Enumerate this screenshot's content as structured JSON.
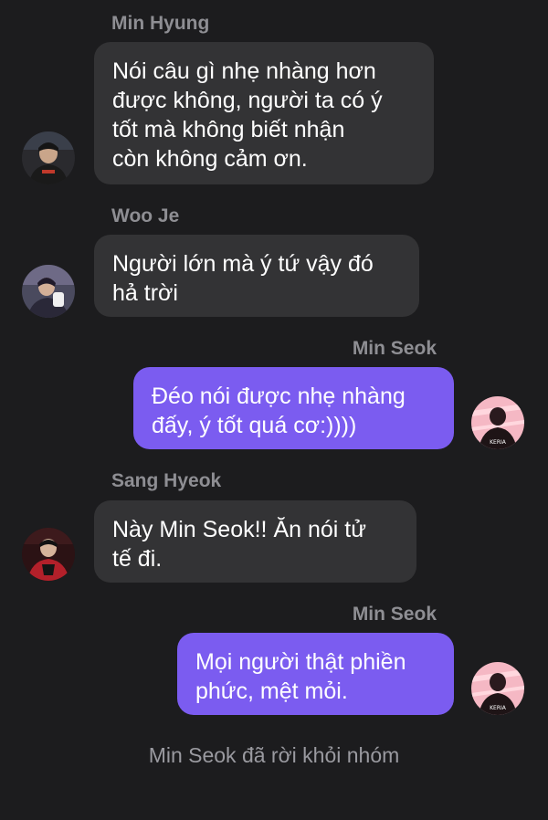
{
  "colors": {
    "background": "#1c1c1e",
    "incoming_bubble": "#333335",
    "outgoing_bubble": "#7b5cf0",
    "sender_name": "#8e8e93"
  },
  "messages": [
    {
      "sender": "Min Hyung",
      "text": "Nói câu gì nhẹ nhàng hơn\nđược không, người ta có ý\ntốt mà không biết nhận\ncòn không cảm ơn.",
      "avatar": "avatar-icon"
    },
    {
      "sender": "Woo Je",
      "text": "Người lớn mà ý tứ vậy đó\nhả trời",
      "avatar": "avatar-icon"
    },
    {
      "sender": "Min Seok",
      "text": "Đéo nói được nhẹ nhàng\nđấy, ý tốt quá cơ:))))",
      "avatar": "avatar-icon"
    },
    {
      "sender": "Sang Hyeok",
      "text": "Này Min Seok!! Ăn nói tử\ntế đi.",
      "avatar": "avatar-icon"
    },
    {
      "sender": "Min Seok",
      "text": "Mọi người thật phiền\nphức, mệt mỏi.",
      "avatar": "avatar-icon"
    }
  ],
  "avatar_texts": {
    "jersey_label": "KERIA"
  },
  "system_message": "Min Seok đã rời khỏi nhóm"
}
